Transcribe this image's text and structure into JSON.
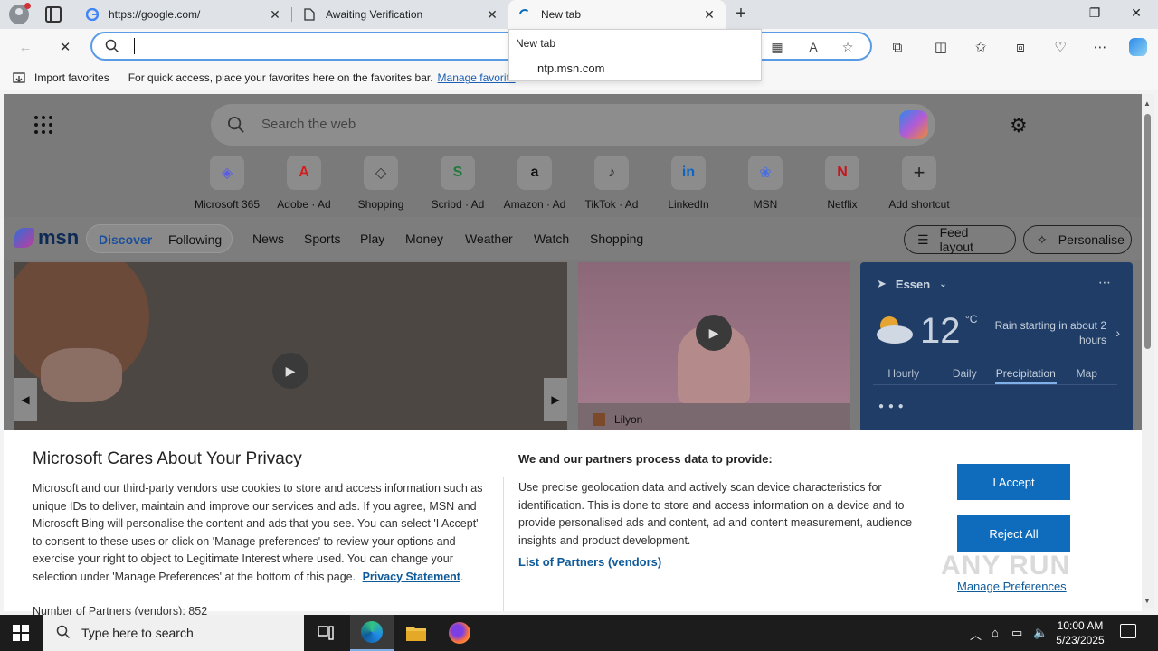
{
  "tabs": [
    {
      "title": "https://google.com/"
    },
    {
      "title": "Awaiting Verification"
    },
    {
      "title": "New tab"
    }
  ],
  "tab_close_glyph": "✕",
  "new_tab_glyph": "+",
  "window_controls": {
    "minimize": "—",
    "restore": "❐",
    "close": "✕"
  },
  "address": {
    "value": "",
    "placeholder": ""
  },
  "favorites_bar": {
    "import_label": "Import favorites",
    "hint": "For quick access, place your favorites here on the favorites bar.",
    "manage_link": "Manage favorite"
  },
  "tab_dropdown": {
    "title": "New tab",
    "url": "ntp.msn.com"
  },
  "ntp": {
    "search_placeholder": "Search the web",
    "shortcuts": [
      {
        "label": "Microsoft 365",
        "glyph": "◈",
        "color": "#5a5ee0"
      },
      {
        "label": "Adobe · Ad",
        "glyph": "A",
        "color": "#d21f1f"
      },
      {
        "label": "Shopping",
        "glyph": "◇",
        "color": "#333333"
      },
      {
        "label": "Scribd · Ad",
        "glyph": "S",
        "color": "#1f7a3a"
      },
      {
        "label": "Amazon · Ad",
        "glyph": "a",
        "color": "#111111"
      },
      {
        "label": "TikTok · Ad",
        "glyph": "♪",
        "color": "#111111"
      },
      {
        "label": "LinkedIn",
        "glyph": "in",
        "color": "#0a66c2"
      },
      {
        "label": "MSN",
        "glyph": "❀",
        "color": "#4a6fe0"
      },
      {
        "label": "Netflix",
        "glyph": "N",
        "color": "#c4161c"
      },
      {
        "label": "Add shortcut",
        "glyph": "+",
        "color": "#222222"
      }
    ],
    "msn": {
      "logo": "msn",
      "segments": {
        "active": "Discover",
        "other": "Following"
      },
      "nav": [
        "News",
        "Sports",
        "Play",
        "Money",
        "Weather",
        "Watch",
        "Shopping"
      ],
      "feed_layout": "Feed layout",
      "personalise": "Personalise"
    },
    "card2_source": "Lilyon",
    "weather": {
      "location": "Essen",
      "temp": "12",
      "unit": "°C",
      "forecast": "Rain starting in about 2 hours",
      "tabs": [
        "Hourly",
        "Daily",
        "Precipitation",
        "Map"
      ],
      "selected_tab": "Precipitation",
      "drops": "💧💧💧"
    }
  },
  "consent": {
    "title": "Microsoft Cares About Your Privacy",
    "body": "Microsoft and our third-party vendors use cookies to store and access information such as unique IDs to deliver, maintain and improve our services and ads. If you agree, MSN and Microsoft Bing will personalise the content and ads that you see. You can select 'I Accept' to consent to these uses or click on 'Manage preferences' to review your options and exercise your right to object to Legitimate Interest where used.  You can change your selection under 'Manage Preferences' at the bottom of this page.",
    "privacy_link": "Privacy Statement",
    "partners_count": "Number of Partners (vendors): 852",
    "data_title": "We and our partners process data to provide:",
    "data_body": "Use precise geolocation data and actively scan device characteristics for identification. This is done to store and access information on a device and to provide personalised ads and content, ad and content measurement, audience insights and product development.",
    "partners_link": "List of Partners (vendors)",
    "accept": "I Accept",
    "reject": "Reject All",
    "manage": "Manage Preferences",
    "watermark": "ANY RUN"
  },
  "taskbar": {
    "search_placeholder": "Type here to search",
    "time": "10:00 AM",
    "date": "5/23/2025"
  },
  "colors": {
    "accent": "#0f6cbd",
    "address_focus": "#5a9be6",
    "weather_bg": "#1f3d66"
  }
}
